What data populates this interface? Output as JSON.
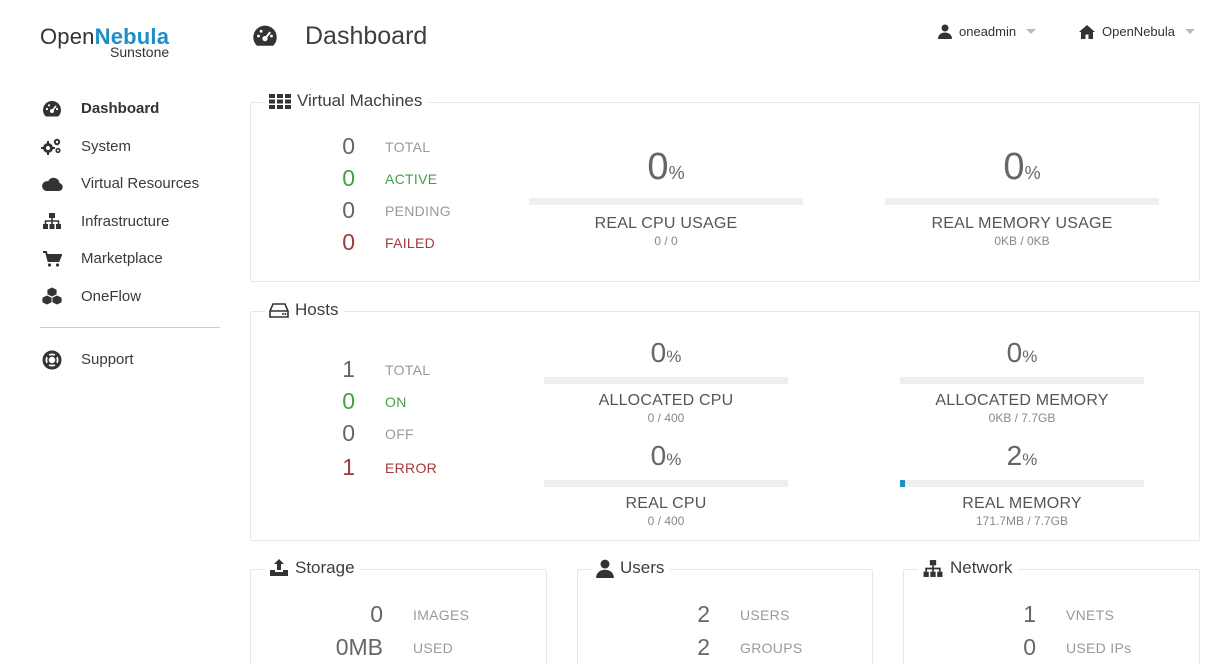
{
  "logo": {
    "prefix": "Open",
    "brand": "Nebula",
    "sub": "Sunstone"
  },
  "sidebar": {
    "items": [
      {
        "label": "Dashboard",
        "icon": "dashboard-icon",
        "active": true
      },
      {
        "label": "System",
        "icon": "cogs-icon"
      },
      {
        "label": "Virtual Resources",
        "icon": "cloud-icon"
      },
      {
        "label": "Infrastructure",
        "icon": "sitemap-icon"
      },
      {
        "label": "Marketplace",
        "icon": "cart-icon"
      },
      {
        "label": "OneFlow",
        "icon": "cubes-icon"
      }
    ],
    "support": {
      "label": "Support",
      "icon": "lifering-icon"
    }
  },
  "header": {
    "title": "Dashboard",
    "user": "oneadmin",
    "zone": "OpenNebula"
  },
  "vms": {
    "title": "Virtual Machines",
    "counts": [
      {
        "value": "0",
        "label": "TOTAL",
        "status": "neutral"
      },
      {
        "value": "0",
        "label": "ACTIVE",
        "status": "green"
      },
      {
        "value": "0",
        "label": "PENDING",
        "status": "neutral"
      },
      {
        "value": "0",
        "label": "FAILED",
        "status": "red"
      }
    ],
    "cpu": {
      "value": "0",
      "unit": "%",
      "name": "REAL CPU USAGE",
      "sub": "0 / 0",
      "fill_percent": 0
    },
    "mem": {
      "value": "0",
      "unit": "%",
      "name": "REAL MEMORY USAGE",
      "sub": "0KB / 0KB",
      "fill_percent": 0
    }
  },
  "hosts": {
    "title": "Hosts",
    "counts": [
      {
        "value": "1",
        "label": "TOTAL",
        "status": "neutral"
      },
      {
        "value": "0",
        "label": "ON",
        "status": "green"
      },
      {
        "value": "0",
        "label": "OFF",
        "status": "neutral"
      },
      {
        "value": "1",
        "label": "ERROR",
        "status": "red"
      }
    ],
    "alloc_cpu": {
      "value": "0",
      "unit": "%",
      "name": "ALLOCATED CPU",
      "sub": "0 / 400",
      "fill_percent": 0
    },
    "alloc_mem": {
      "value": "0",
      "unit": "%",
      "name": "ALLOCATED MEMORY",
      "sub": "0KB / 7.7GB",
      "fill_percent": 0
    },
    "real_cpu": {
      "value": "0",
      "unit": "%",
      "name": "REAL CPU",
      "sub": "0 / 400",
      "fill_percent": 0
    },
    "real_mem": {
      "value": "2",
      "unit": "%",
      "name": "REAL MEMORY",
      "sub": "171.7MB / 7.7GB",
      "fill_percent": 2
    }
  },
  "storage": {
    "title": "Storage",
    "stats": [
      {
        "value": "0",
        "label": "IMAGES"
      },
      {
        "value": "0MB",
        "label": "USED"
      }
    ]
  },
  "users": {
    "title": "Users",
    "stats": [
      {
        "value": "2",
        "label": "USERS"
      },
      {
        "value": "2",
        "label": "GROUPS"
      }
    ]
  },
  "network": {
    "title": "Network",
    "stats": [
      {
        "value": "1",
        "label": "VNETS"
      },
      {
        "value": "0",
        "label": "USED IPs"
      }
    ]
  },
  "colors": {
    "accent": "#1d8fc6",
    "green": "#43a047",
    "red": "#a33a3a"
  }
}
